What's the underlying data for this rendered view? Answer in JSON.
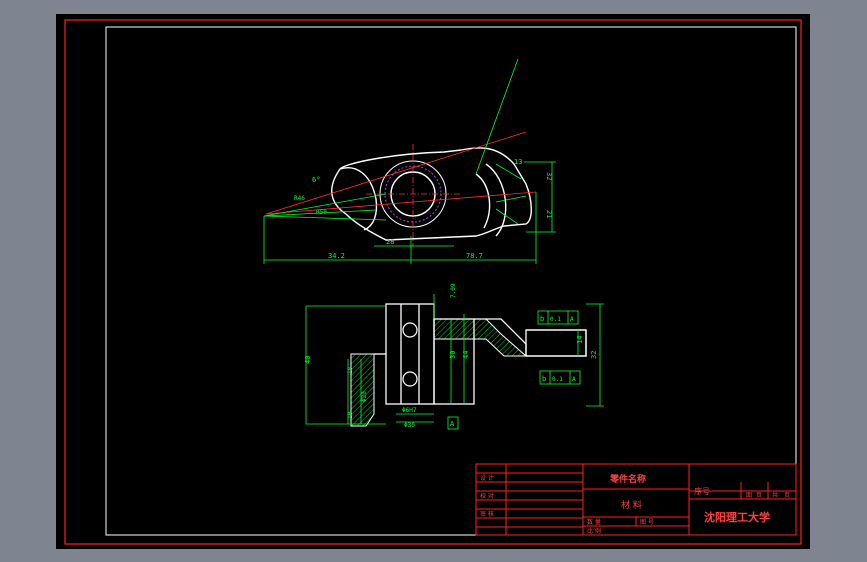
{
  "title_block": {
    "part_name_label": "零件名称",
    "material_label": "材 料",
    "sequence_label": "序号",
    "sheet_labels": [
      "图",
      "页",
      "共",
      "页"
    ],
    "university": "沈阳理工大学",
    "roles": [
      "设 计",
      "校 对",
      "审 核"
    ],
    "quantity_labels": [
      "数 量",
      "图 号"
    ],
    "drawing_label": "比 例"
  },
  "dimensions": {
    "top_view": [
      "34.2",
      "78.7",
      "28",
      "32",
      "21",
      "13",
      "6°",
      "R46",
      "R50"
    ],
    "front_view": [
      "40",
      "30",
      "44",
      "14",
      "32",
      "7.09",
      "Φ30",
      "Φ6H7",
      "10",
      "18",
      "Φ20",
      "A"
    ]
  },
  "tolerance_frames": [
    {
      "symbol": "b",
      "value": "0.1",
      "datum": "A"
    },
    {
      "symbol": "b",
      "value": "0.1",
      "datum": "A"
    }
  ],
  "colors": {
    "outer_frame": "#ff2020",
    "border": "#ffffff",
    "geometry": "#ffffff",
    "dimension": "#00ff33",
    "center_line": "#ff3030",
    "hidden_circle": "#c040ff",
    "title_text": "#ff4040"
  }
}
